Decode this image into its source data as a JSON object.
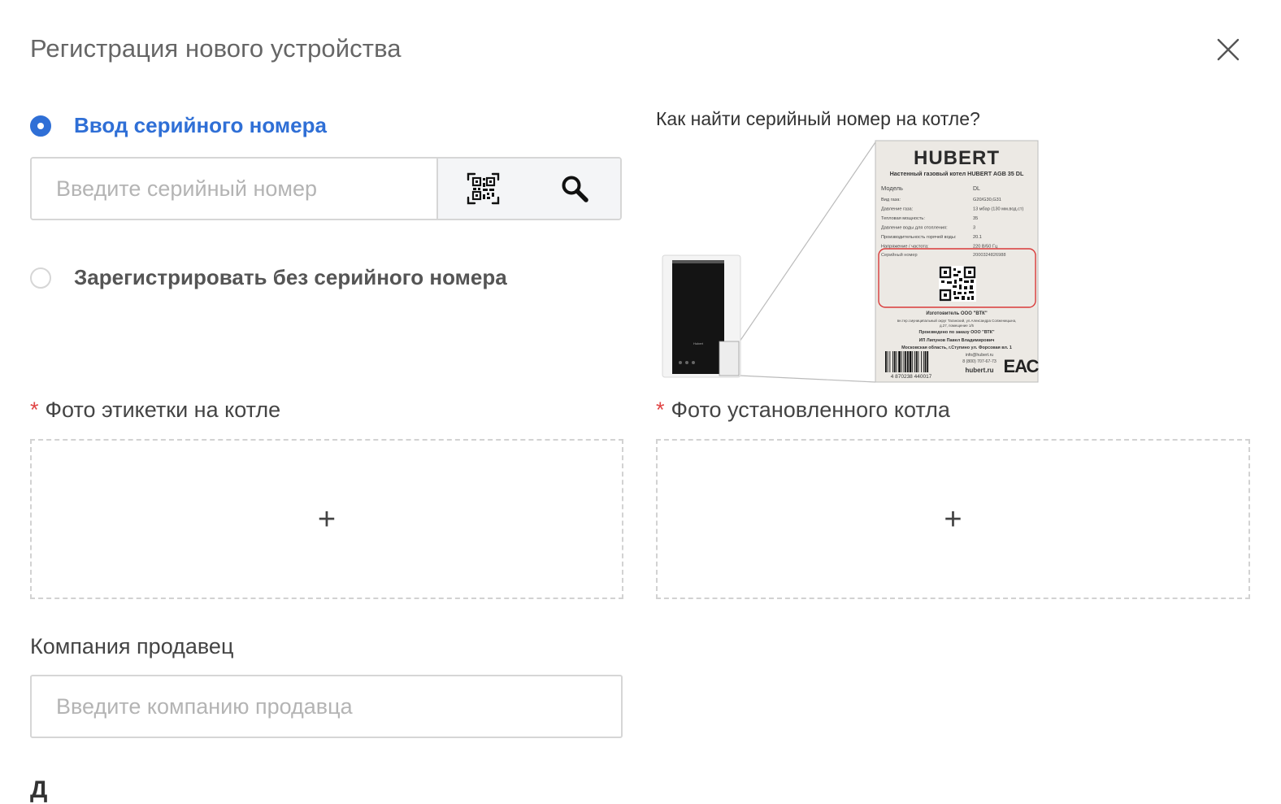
{
  "dialog": {
    "title": "Регистрация нового устройства",
    "close_icon": "close-icon"
  },
  "options": {
    "serial": {
      "label": "Ввод серийного номера",
      "selected": true,
      "placeholder": "Введите серийный номер",
      "value": "",
      "qr_icon": "qr-scan-icon",
      "search_icon": "search-icon"
    },
    "no_serial": {
      "label": "Зарегистрировать без серийного номера",
      "selected": false
    }
  },
  "hint": {
    "title": "Как найти серийный номер на котле?",
    "label": {
      "brand": "HUBERT",
      "product": "Настенный газовый котел HUBERT AGB 35 DL",
      "model_key": "Модель",
      "model_value": "DL",
      "rows": [
        {
          "k": "Вид газа:",
          "v": "G20/G30,G31"
        },
        {
          "k": "Давление газа:",
          "v": "13 мбар (130 мм.вод.ст)"
        },
        {
          "k": "Тепловая мощность:",
          "v": "35"
        },
        {
          "k": "Давление воды для отопления:",
          "v": "3"
        },
        {
          "k": "Производительность горячей воды:",
          "v": "20.1"
        },
        {
          "k": "Напряжение / частота:",
          "v": "220 В/50 Гц"
        }
      ],
      "serial_key": "Серийный номер",
      "serial_value": "2000324826988",
      "maker": "Изготовитель ООО \"ВТК\"",
      "address_1": "вн.тер.г.муниципальный округ Таганский, ул.Александра Солженицына,",
      "address_2": "д.27, помещение 1/5",
      "ordered_by": "Произведено по заказу ООО \"ВТК\"",
      "person": "ИП Липунов Павел Владимирович",
      "region": "Московская область, г.Ступино ул. Форсовая вл. 1",
      "email": "info@hubert.ru",
      "phone": "8 (800) 707-67-73",
      "site": "hubert.ru",
      "barcode_number": "4 870238 440017",
      "mark": "ЕАС"
    },
    "boiler_brand": "Hubert"
  },
  "uploads": {
    "label_photo": {
      "label": "Фото этикетки на котле",
      "required_mark": "*",
      "plus": "+",
      "plus_icon": "plus-icon"
    },
    "installed_photo": {
      "label": "Фото установленного котла",
      "required_mark": "*",
      "plus": "+",
      "plus_icon": "plus-icon"
    }
  },
  "seller": {
    "label": "Компания продавец",
    "placeholder": "Введите компанию продавца",
    "value": ""
  },
  "next_section_heading": "Д",
  "colors": {
    "accent": "#2f6fd6",
    "required": "#e04545",
    "border": "#d6d6d6",
    "placeholder": "#b4b4b4",
    "label_highlight": "#d93a3a"
  }
}
